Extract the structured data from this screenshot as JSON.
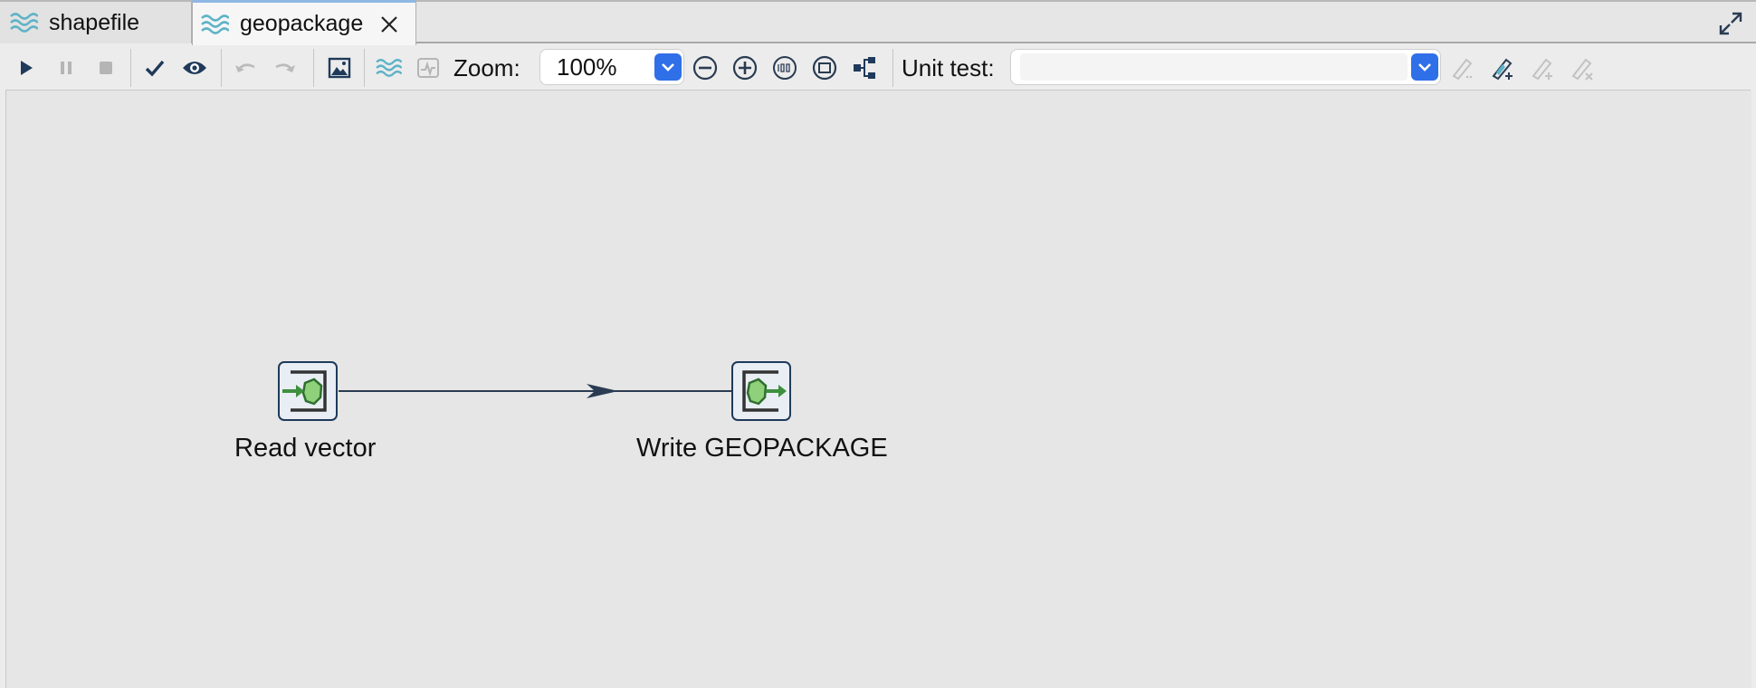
{
  "tabs": [
    {
      "label": "shapefile",
      "active": false,
      "icon": "transformation-icon"
    },
    {
      "label": "geopackage",
      "active": true,
      "icon": "transformation-icon",
      "closable": true
    }
  ],
  "toolbar": {
    "zoom_label": "Zoom:",
    "zoom_value": "100%",
    "unit_test_label": "Unit test:",
    "unit_test_value": "",
    "buttons": [
      "run-icon",
      "pause-icon",
      "stop-icon",
      "check-icon",
      "preview-icon",
      "undo-icon",
      "redo-icon",
      "image-export-icon",
      "transformation-icon",
      "impact-icon",
      "zoom-out-icon",
      "zoom-in-icon",
      "zoom-100-icon",
      "zoom-fit-icon",
      "arrange-icon",
      "unit-test-edit-icon",
      "unit-test-new-icon",
      "unit-test-add-icon",
      "unit-test-delete-icon"
    ]
  },
  "canvas": {
    "steps": [
      {
        "name": "read-vector",
        "label": "Read vector",
        "icon": "vector-input-icon"
      },
      {
        "name": "write-geopackage",
        "label": "Write GEOPACKAGE",
        "icon": "vector-output-icon"
      }
    ],
    "hops": [
      {
        "from": "Read vector",
        "to": "Write GEOPACKAGE"
      }
    ]
  },
  "colors": {
    "accent": "#2f6fe8",
    "step_border": "#1f3a5a",
    "step_icon_green": "#3e8f3e",
    "hop_line": "#2a3b52",
    "wave_icon": "#5fb3c7"
  }
}
